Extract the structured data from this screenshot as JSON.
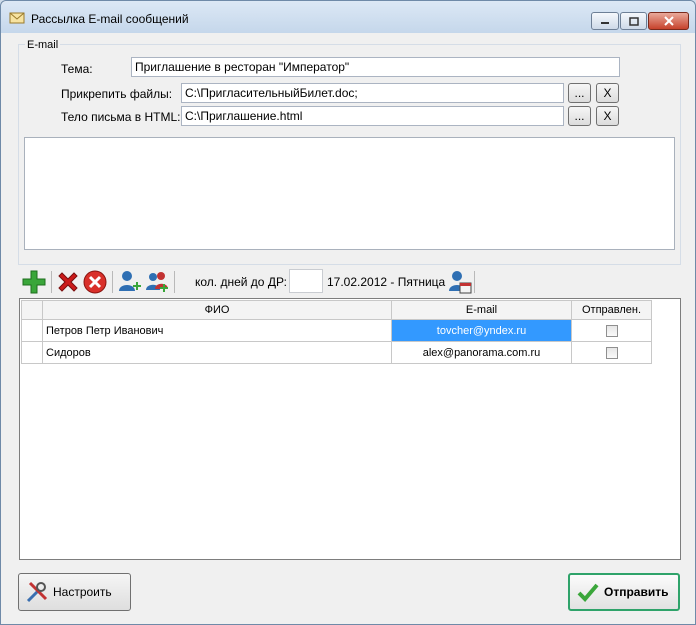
{
  "window": {
    "title": "Рассылка E-mail сообщений",
    "icon": "envelope-icon"
  },
  "email_group": {
    "legend": "E-mail",
    "subject_label": "Тема:",
    "subject_value": "Приглашение в ресторан \"Император\"",
    "attach_label": "Прикрепить файлы:",
    "attach_value": "C:\\ПригласительныйБилет.doc;",
    "body_label": "Тело письма в HTML:",
    "body_value": "C:\\Приглашение.html",
    "browse_label": "...",
    "clear_label": "X"
  },
  "toolbar": {
    "days_label": "кол. дней до ДР:",
    "days_value": "",
    "date_text": "17.02.2012 - Пятница",
    "icons": [
      "add-icon",
      "delete-icon",
      "cancel-icon",
      "add-contact-icon",
      "add-group-icon",
      "calendar-contact-icon"
    ]
  },
  "grid": {
    "columns": [
      "ФИО",
      "E-mail",
      "Отправлен."
    ],
    "rows": [
      {
        "name": "Петров Петр Иванович",
        "email": "tovcher@yndex.ru",
        "sent": false,
        "selected": true
      },
      {
        "name": "Сидоров",
        "email": "alex@panorama.com.ru",
        "sent": false,
        "selected": false
      }
    ]
  },
  "buttons": {
    "setup_label": "Настроить",
    "send_label": "Отправить"
  },
  "colors": {
    "selection": "#3399ff",
    "send_border": "#2fa36a",
    "add_green": "#3aa63a",
    "delete_red": "#cc1b1b"
  }
}
